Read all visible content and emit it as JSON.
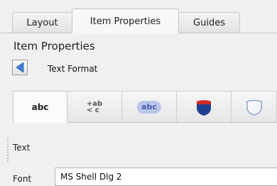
{
  "tabs": [
    {
      "label": "Layout"
    },
    {
      "label": "Item Properties",
      "active": true
    },
    {
      "label": "Guides"
    }
  ],
  "panel": {
    "title": "Item Properties",
    "subtitle": "Text Format"
  },
  "format_tabs": [
    {
      "icon": "text-icon",
      "label": "abc",
      "active": true
    },
    {
      "icon": "formatting-icon",
      "top": "+ab",
      "bottom": "< c"
    },
    {
      "icon": "background-icon",
      "label": "abc"
    },
    {
      "icon": "shadow-shield-icon"
    },
    {
      "icon": "callout-shield-icon"
    }
  ],
  "section": {
    "label": "Text"
  },
  "font": {
    "label": "Font",
    "value": "MS Shell Dlg 2"
  },
  "colors": {
    "shield_red": "#d32a2a",
    "shield_blue": "#1f3f8f",
    "pill_bg": "#b9c6ea",
    "pill_text": "#4a5cb0",
    "back_arrow": "#3d7fd6"
  }
}
